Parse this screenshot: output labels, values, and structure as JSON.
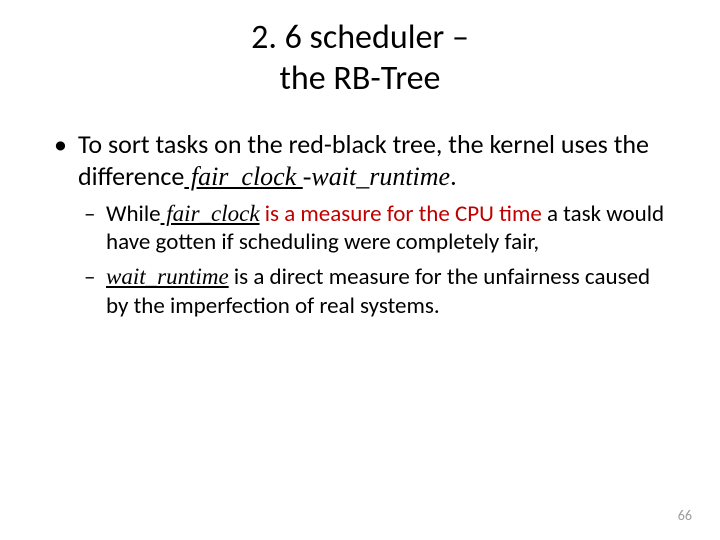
{
  "title_line1": "2. 6 scheduler –",
  "title_line2": "the RB-Tree",
  "bullet1_pre": "To sort tasks on the red-black tree, the kernel uses the difference",
  "fair_clock": " fair_clock ",
  "minus_wait": "-wait_runtime",
  "period": ".",
  "sub1_pre": "While",
  "sub1_fair": " fair_clock",
  "sub1_red": " is a measure for the CPU time",
  "sub1_rest": " a task would have gotten if scheduling were completely fair,",
  "sub2_wait": "wait_runtime",
  "sub2_rest": " is a direct measure for the unfairness caused by the imperfection of real systems.",
  "page_number": "66"
}
